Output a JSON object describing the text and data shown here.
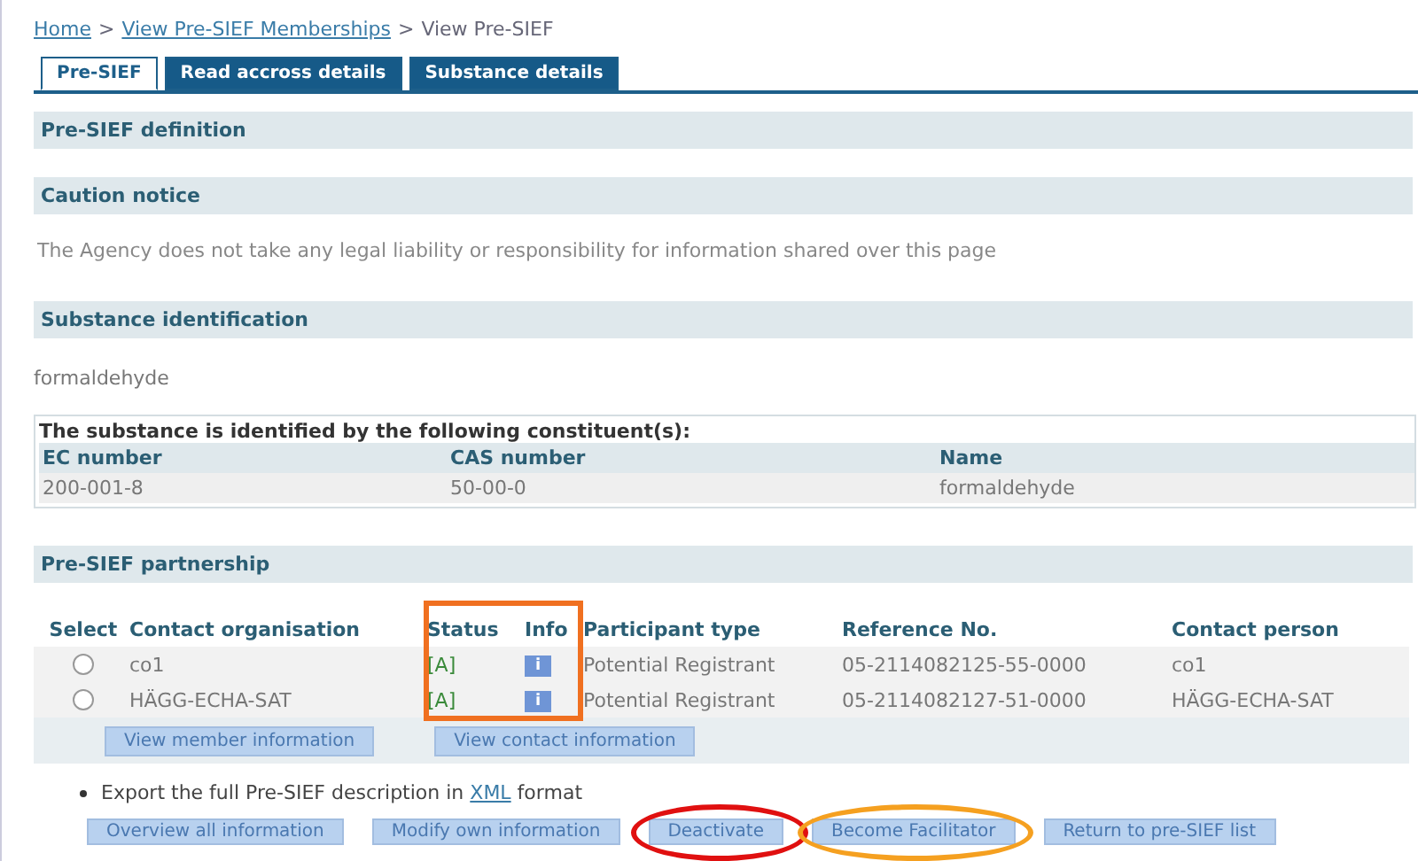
{
  "breadcrumb": [
    {
      "label": "Home",
      "link": true
    },
    {
      "label": ">",
      "link": false
    },
    {
      "label": "View Pre-SIEF Memberships",
      "link": true
    },
    {
      "label": ">",
      "link": false
    },
    {
      "label": "View Pre-SIEF",
      "link": false
    }
  ],
  "tabs": [
    {
      "label": "Pre-SIEF",
      "selected": true
    },
    {
      "label": "Read accross details",
      "selected": false
    },
    {
      "label": "Substance details",
      "selected": false
    }
  ],
  "definition": {
    "title": "Pre-SIEF definition"
  },
  "caution": {
    "title": "Caution notice",
    "text": "The Agency does not take any legal liability or responsibility for information shared over this page"
  },
  "substance": {
    "title": "Substance identification",
    "name": "formaldehyde",
    "constituents_title": "The substance is identified by the following constituent(s):",
    "columns": [
      "EC number",
      "CAS number",
      "Name"
    ],
    "rows": [
      [
        "200-001-8",
        "50-00-0",
        "formaldehyde"
      ]
    ]
  },
  "partnership": {
    "title": "Pre-SIEF partnership",
    "columns": [
      "Select",
      "Contact organisation",
      "Status",
      "Info",
      "Participant type",
      "Reference No.",
      "Contact person"
    ],
    "rows": [
      {
        "selected": false,
        "organisation": "co1",
        "status": "[A]",
        "info": "i",
        "type": "Potential Registrant",
        "reference": "05-2114082125-55-0000",
        "contact": "co1"
      },
      {
        "selected": false,
        "organisation": "HÄGG-ECHA-SAT",
        "status": "[A]",
        "info": "i",
        "type": "Potential Registrant",
        "reference": "05-2114082127-51-0000",
        "contact": "HÄGG-ECHA-SAT"
      }
    ],
    "buttons": [
      "View member information",
      "View contact information"
    ]
  },
  "export": {
    "before": "Export the full Pre-SIEF description in",
    "link": "XML",
    "after": "format"
  },
  "actions": [
    "Overview all information",
    "Modify own information",
    "Deactivate",
    "Become Facilitator",
    "Return to pre-SIEF list"
  ]
}
